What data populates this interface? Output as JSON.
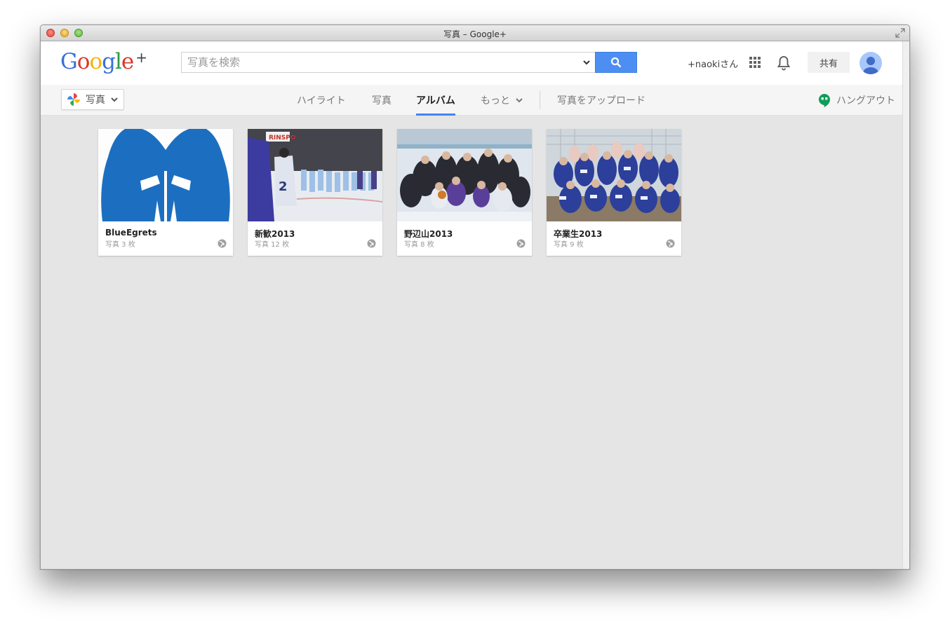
{
  "window": {
    "title": "写真 – Google+"
  },
  "header": {
    "logo": {
      "letters": [
        "G",
        "o",
        "o",
        "g",
        "l",
        "e"
      ],
      "colors": [
        "#3b6fd8",
        "#d9372a",
        "#f2b500",
        "#3b6fd8",
        "#2e9c46",
        "#d9372a"
      ],
      "plus": "+"
    },
    "search": {
      "placeholder": "写真を検索",
      "value": ""
    },
    "user_name": "+naokiさん",
    "share_label": "共有"
  },
  "nav": {
    "app_switch_label": "写真",
    "tabs": [
      {
        "label": "ハイライト",
        "active": false
      },
      {
        "label": "写真",
        "active": false
      },
      {
        "label": "アルバム",
        "active": true
      },
      {
        "label": "もっと",
        "active": false
      }
    ],
    "upload_label": "写真をアップロード",
    "hangout_label": "ハングアウト"
  },
  "albums": [
    {
      "name": "BlueEgrets",
      "count": "写真 3 枚",
      "visibility": "public"
    },
    {
      "name": "新歓2013",
      "count": "写真 12 枚",
      "visibility": "public"
    },
    {
      "name": "野辺山2013",
      "count": "写真 8 枚",
      "visibility": "public"
    },
    {
      "name": "卒業生2013",
      "count": "写真 9 枚",
      "visibility": "public"
    }
  ],
  "colors": {
    "accent": "#4285f4",
    "search_button": "#4d8ef3",
    "egret_logo_blue": "#1c6fc0"
  }
}
